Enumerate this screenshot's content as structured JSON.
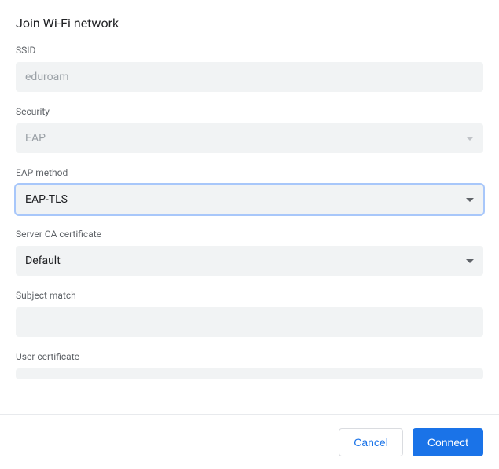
{
  "title": "Join Wi-Fi network",
  "fields": {
    "ssid": {
      "label": "SSID",
      "value": "eduroam"
    },
    "security": {
      "label": "Security",
      "value": "EAP"
    },
    "eap_method": {
      "label": "EAP method",
      "value": "EAP-TLS"
    },
    "server_ca": {
      "label": "Server CA certificate",
      "value": "Default"
    },
    "subject_match": {
      "label": "Subject match",
      "value": ""
    },
    "user_certificate": {
      "label": "User certificate",
      "value": ""
    }
  },
  "buttons": {
    "cancel": "Cancel",
    "connect": "Connect"
  }
}
